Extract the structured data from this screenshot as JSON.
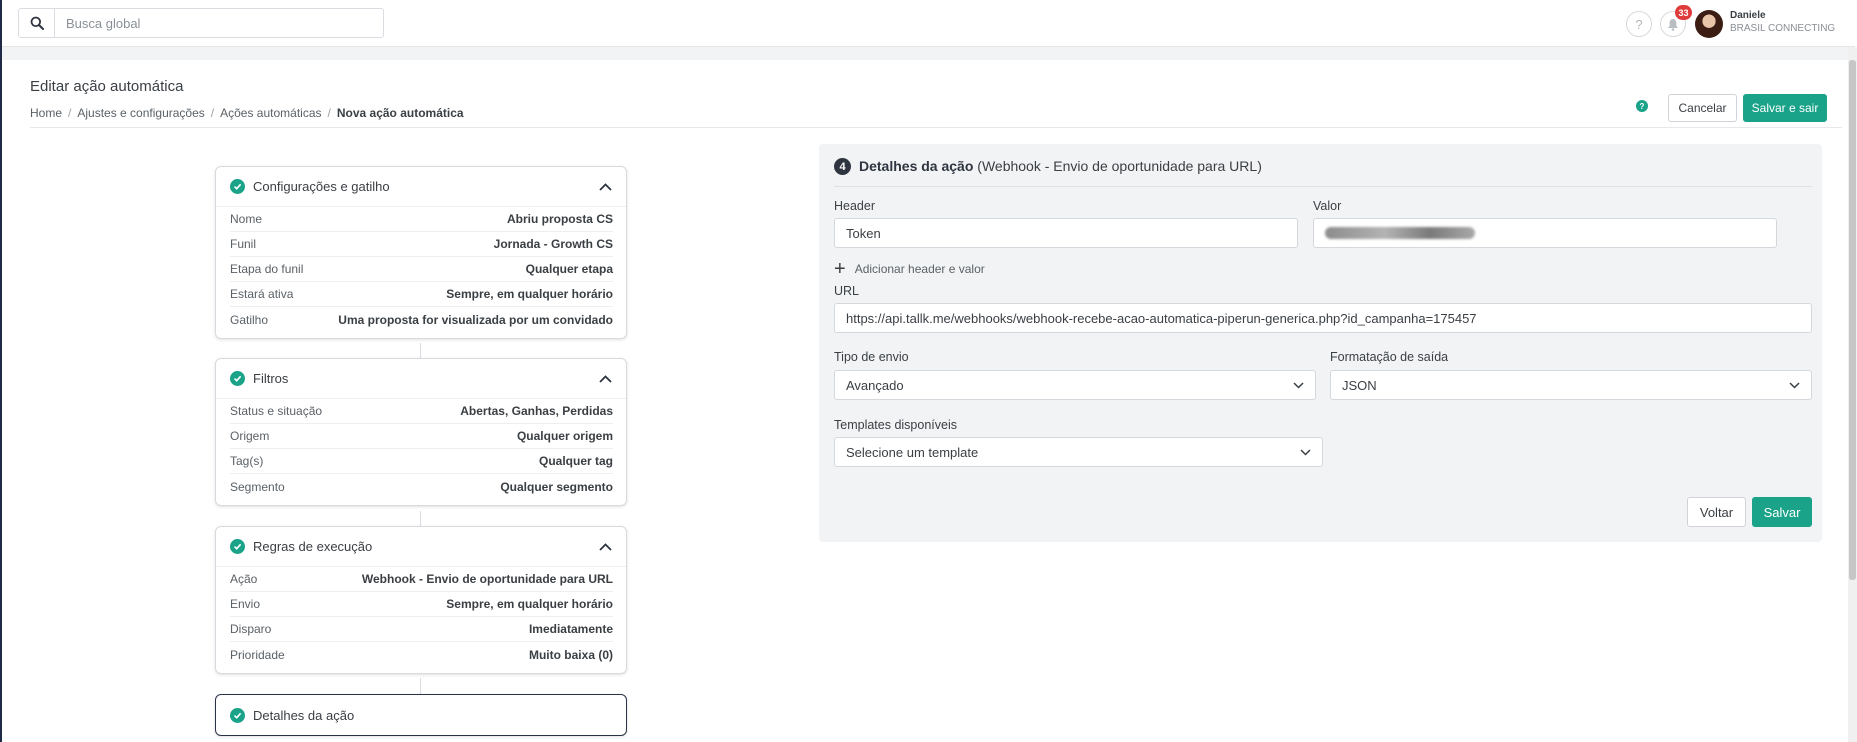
{
  "topbar": {
    "search_placeholder": "Busca global",
    "notifications_count": "33",
    "help_glyph": "?",
    "user_name": "Daniele",
    "user_company": "BRASIL CONNECTING"
  },
  "page": {
    "title": "Editar ação automática",
    "breadcrumb": [
      "Home",
      "Ajustes e configurações",
      "Ações automáticas",
      "Nova ação automática"
    ],
    "separator": "/",
    "cancel_label": "Cancelar",
    "save_exit_label": "Salvar e sair",
    "info_glyph": "?"
  },
  "steps": [
    {
      "title": "Configurações e gatilho",
      "rows": [
        {
          "k": "Nome",
          "v": "Abriu proposta CS"
        },
        {
          "k": "Funil",
          "v": "Jornada - Growth CS"
        },
        {
          "k": "Etapa do funil",
          "v": "Qualquer etapa"
        },
        {
          "k": "Estará ativa",
          "v": "Sempre, em qualquer horário"
        },
        {
          "k": "Gatilho",
          "v": "Uma proposta for visualizada por um convidado"
        }
      ]
    },
    {
      "title": "Filtros",
      "rows": [
        {
          "k": "Status e situação",
          "v": "Abertas, Ganhas, Perdidas"
        },
        {
          "k": "Origem",
          "v": "Qualquer origem"
        },
        {
          "k": "Tag(s)",
          "v": "Qualquer tag"
        },
        {
          "k": "Segmento",
          "v": "Qualquer segmento"
        }
      ]
    },
    {
      "title": "Regras de execução",
      "rows": [
        {
          "k": "Ação",
          "v": "Webhook - Envio de oportunidade para URL"
        },
        {
          "k": "Envio",
          "v": "Sempre, em qualquer horário"
        },
        {
          "k": "Disparo",
          "v": "Imediatamente"
        },
        {
          "k": "Prioridade",
          "v": "Muito baixa (0)"
        }
      ]
    },
    {
      "title": "Detalhes da ação",
      "rows": []
    }
  ],
  "details": {
    "step_number": "4",
    "title": "Detalhes da ação",
    "subtitle": "(Webhook - Envio de oportunidade para URL)",
    "header_label": "Header",
    "header_value": "Token",
    "valor_label": "Valor",
    "add_header_label": "Adicionar header e valor",
    "url_label": "URL",
    "url_value": "https://api.tallk.me/webhooks/webhook-recebe-acao-automatica-piperun-generica.php?id_campanha=175457",
    "tipo_label": "Tipo de envio",
    "tipo_value": "Avançado",
    "formato_label": "Formatação de saída",
    "formato_value": "JSON",
    "templates_label": "Templates disponíveis",
    "templates_placeholder": "Selecione um template",
    "voltar_label": "Voltar",
    "salvar_label": "Salvar"
  },
  "colors": {
    "accent": "#1aa389",
    "badge": "#e03b3b",
    "dark": "#2f3540"
  }
}
